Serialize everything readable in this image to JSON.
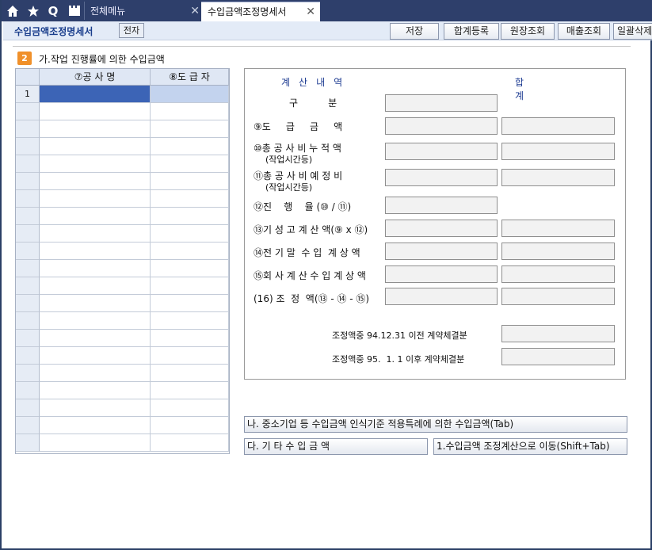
{
  "tabbar": {
    "icons": [
      "home-icon",
      "star-icon",
      "search-icon",
      "clapperboard-icon"
    ],
    "search_glyph": "Q",
    "tabs": [
      {
        "label": "전체메뉴",
        "close": "✕"
      },
      {
        "label": "수입금액조정명세서",
        "close": "✕"
      }
    ]
  },
  "toolbar": {
    "title": "수입금액조정명세서",
    "electronic_label": "전자",
    "buttons": [
      "저장",
      "합계등록",
      "원장조회",
      "매출조회",
      "일괄삭제"
    ]
  },
  "section": {
    "badge": "2",
    "title": "가.작업 진행률에 의한 수입금액"
  },
  "grid": {
    "columns": [
      "⑦공 사 명",
      "⑧도 급 자"
    ],
    "first_row_number": "1",
    "row_count": 21
  },
  "calc": {
    "header_left": "계산내역",
    "header_right": "합계",
    "rows": [
      {
        "label": "구          분",
        "sub": ""
      },
      {
        "label": "⑨도     급     금     액",
        "sub": ""
      },
      {
        "label": "⑩총 공 사 비 누 적 액",
        "sub": "(작업시간등)"
      },
      {
        "label": "⑪총 공 사 비 예 정 비",
        "sub": "(작업시간등)"
      },
      {
        "label": "⑫진    행    율 (⑩ / ⑪)",
        "sub": ""
      },
      {
        "label": "⑬기 성 고 계 산 액(⑨ x ⑫)",
        "sub": ""
      },
      {
        "label": "⑭전 기 말  수 입  계 상 액",
        "sub": ""
      },
      {
        "label": "⑮회 사 계 산 수 입 계 상 액",
        "sub": ""
      },
      {
        "label": "(16) 조  정  액(⑬ - ⑭ - ⑮)",
        "sub": ""
      }
    ],
    "notes": [
      "조정액중 94.12.31 이전 계약체결분",
      "조정액중 95.  1. 1 이후 계약체결분"
    ]
  },
  "bottom_buttons": {
    "na": "나. 중소기업 등 수입금액 인식기준 적용특례에 의한 수입금액(Tab)",
    "da": "다. 기 타 수 입 금 액",
    "move": "1.수입금액 조정계산으로 이동(Shift+Tab)"
  }
}
